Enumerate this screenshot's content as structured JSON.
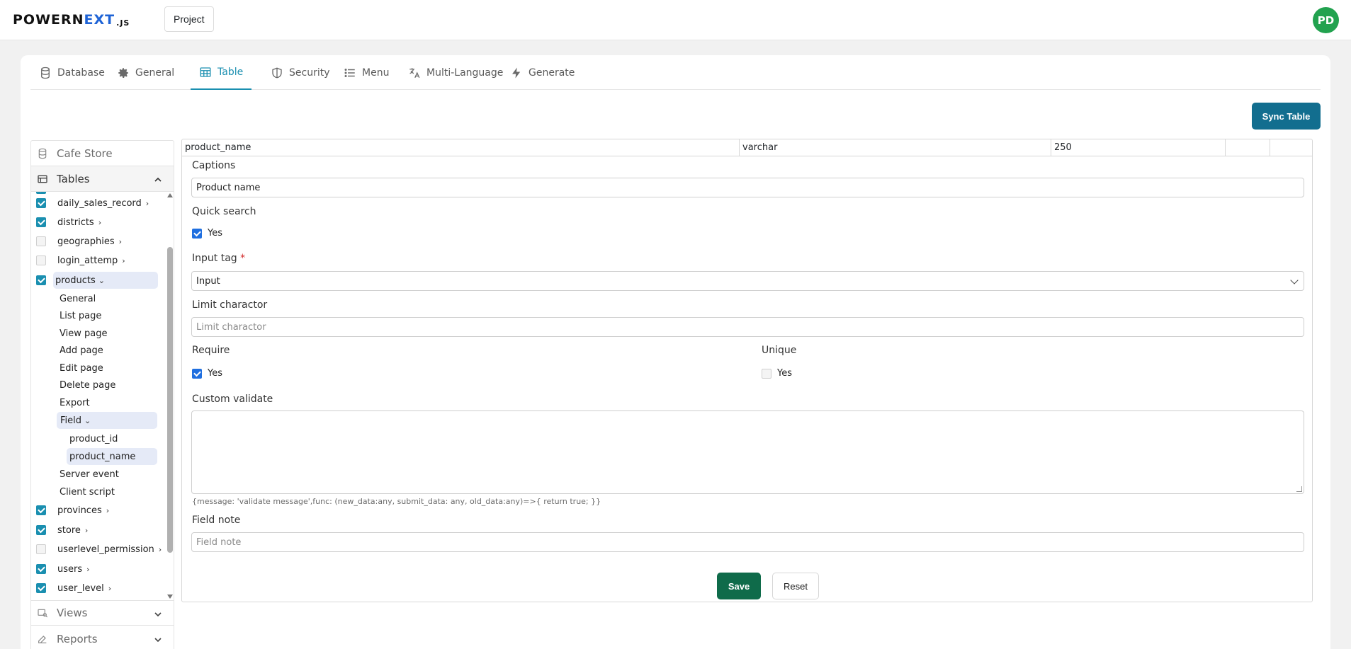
{
  "header": {
    "logo_prefix": "POWERN",
    "logo_x": "EXT",
    "logo_suffix": ".JS",
    "project_label": "Project",
    "avatar_initials": "PD",
    "avatar_color": "#22a24f"
  },
  "tabs": [
    {
      "label": "Database",
      "icon": "database-icon"
    },
    {
      "label": "General",
      "icon": "gear-icon"
    },
    {
      "label": "Table",
      "icon": "table-icon",
      "active": true
    },
    {
      "label": "Security",
      "icon": "shield-icon"
    },
    {
      "label": "Menu",
      "icon": "list-icon"
    },
    {
      "label": "Multi-Language",
      "icon": "translate-icon"
    },
    {
      "label": "Generate",
      "icon": "bolt-icon"
    }
  ],
  "sync_button_label": "Sync Table",
  "left_panel": {
    "project_name": "Cafe Store",
    "tables_label": "Tables",
    "views_label": "Views",
    "reports_label": "Reports",
    "tables": [
      {
        "name": "daily_sales_record",
        "checked": true
      },
      {
        "name": "districts",
        "checked": true
      },
      {
        "name": "geographies",
        "checked": false
      },
      {
        "name": "login_attemp",
        "checked": false
      },
      {
        "name": "products",
        "checked": true,
        "expanded": true
      },
      {
        "name": "provinces",
        "checked": true
      },
      {
        "name": "store",
        "checked": true
      },
      {
        "name": "userlevel_permission",
        "checked": false
      },
      {
        "name": "users",
        "checked": true
      },
      {
        "name": "user_level",
        "checked": true
      }
    ],
    "product_children": [
      "General",
      "List page",
      "View page",
      "Add page",
      "Edit page",
      "Delete page",
      "Export"
    ],
    "field_label": "Field",
    "fields": [
      "product_id",
      "product_name"
    ],
    "product_children_after": [
      "Server event",
      "Client script"
    ]
  },
  "form": {
    "field_name": "product_name",
    "field_type": "varchar",
    "field_length": "250",
    "captions_label": "Captions",
    "captions_value": "Product name",
    "quick_search_label": "Quick search",
    "quick_search_option": "Yes",
    "quick_search_checked": true,
    "input_tag_label": "Input tag",
    "required_mark": "*",
    "input_tag_value": "Input",
    "limit_label": "Limit charactor",
    "limit_placeholder": "Limit charactor",
    "require_label": "Require",
    "require_option": "Yes",
    "require_checked": true,
    "unique_label": "Unique",
    "unique_option": "Yes",
    "unique_checked": false,
    "custom_validate_label": "Custom validate",
    "custom_validate_hint": "{message: 'validate message',func: (new_data:any, submit_data: any, old_data:any)=>{ return true; }}",
    "field_note_label": "Field note",
    "field_note_placeholder": "Field note",
    "save_label": "Save",
    "reset_label": "Reset"
  }
}
